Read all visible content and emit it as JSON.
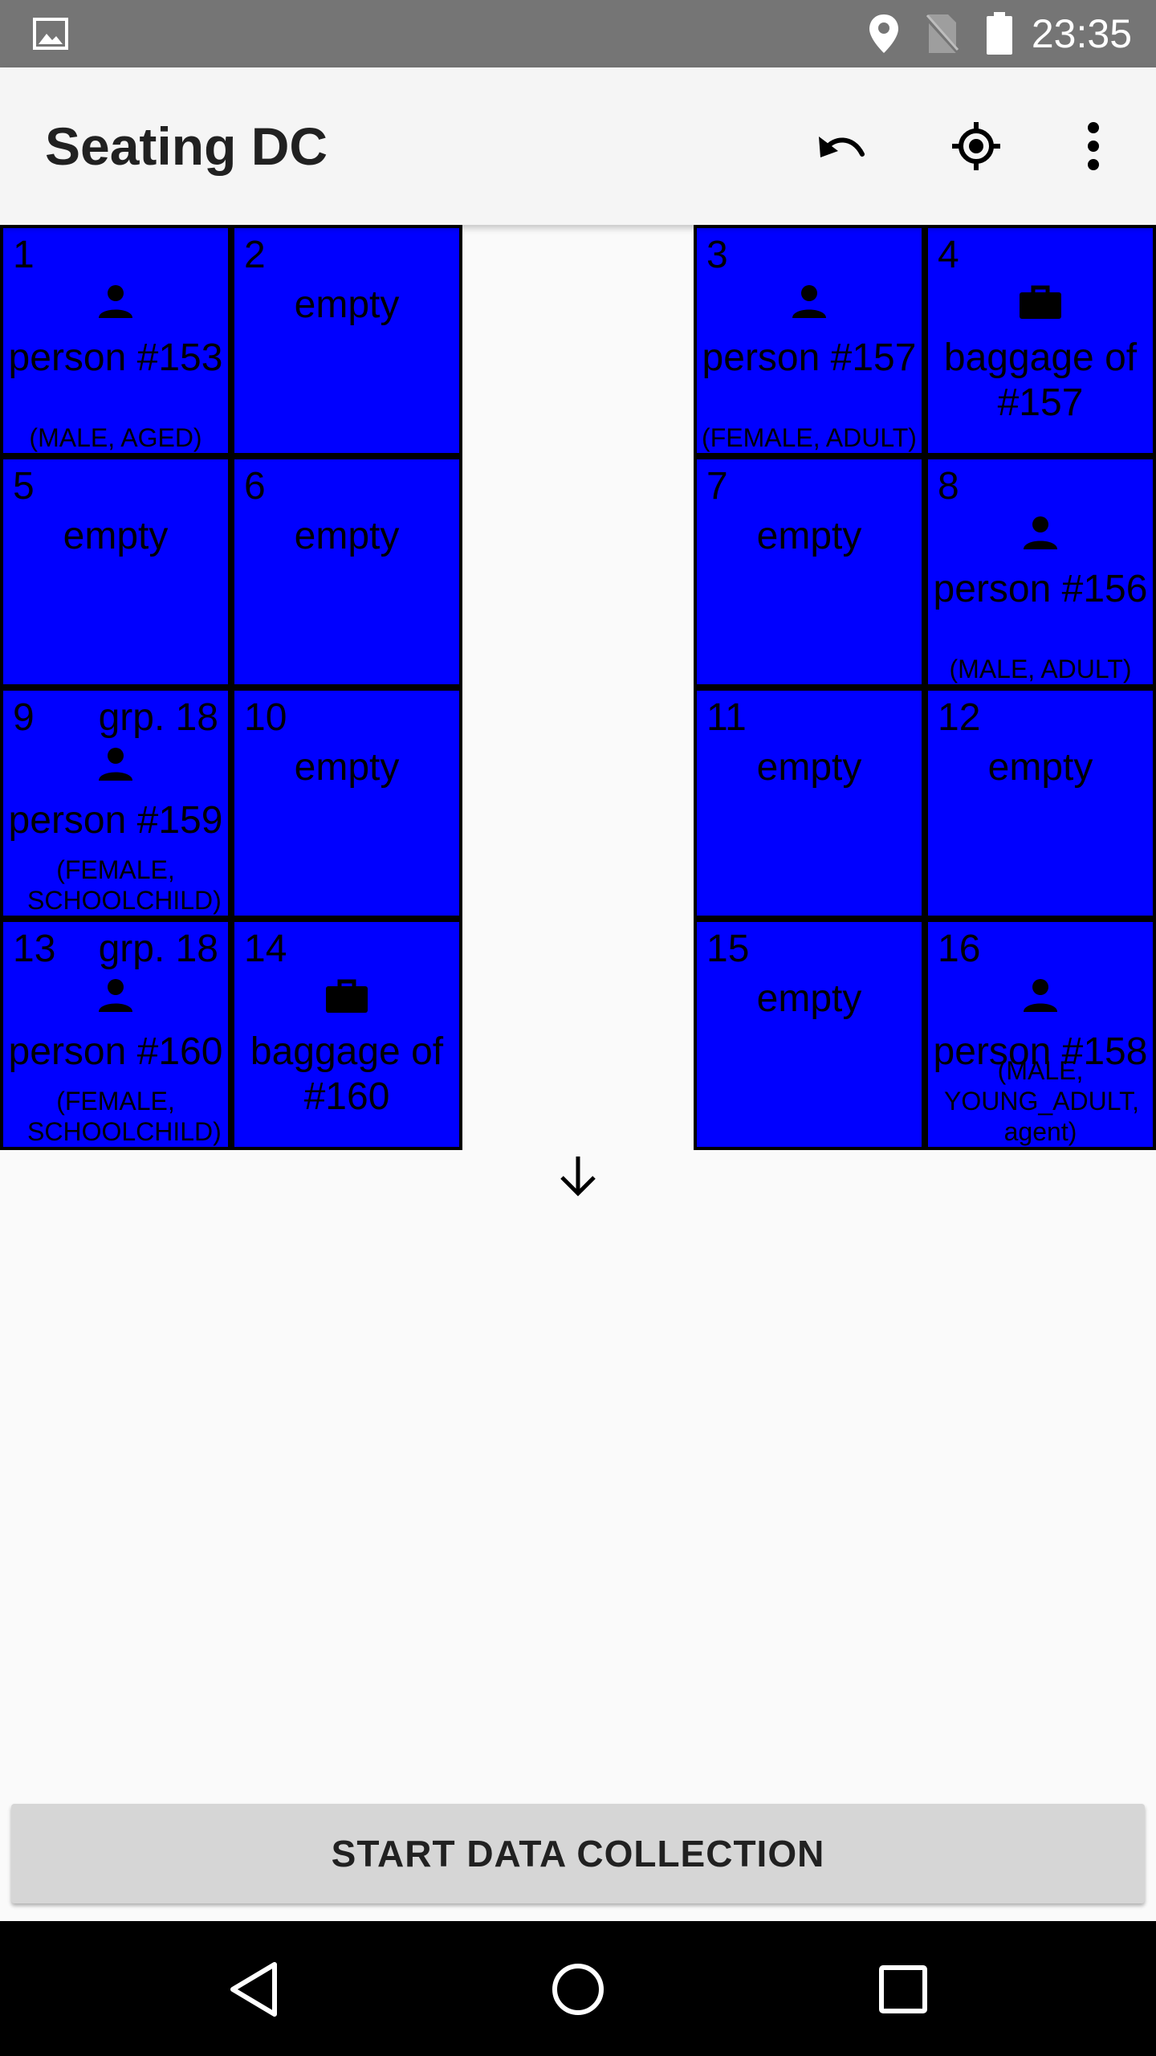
{
  "status_bar": {
    "time": "23:35",
    "icons": [
      "image-icon",
      "location-icon",
      "no-sim-icon",
      "battery-icon"
    ]
  },
  "app_bar": {
    "title": "Seating DC",
    "actions": [
      "undo-icon",
      "locate-icon",
      "more-vert-icon"
    ]
  },
  "seats": [
    {
      "number": "1",
      "group": "",
      "icon": "person",
      "label": "person #153",
      "detail": "(MALE, AGED)"
    },
    {
      "number": "2",
      "group": "",
      "icon": "",
      "label": "empty",
      "detail": ""
    },
    {
      "number": "3",
      "group": "",
      "icon": "person",
      "label": "person #157",
      "detail": "(FEMALE, ADULT)"
    },
    {
      "number": "4",
      "group": "",
      "icon": "baggage",
      "label": "baggage of #157",
      "detail": ""
    },
    {
      "number": "5",
      "group": "",
      "icon": "",
      "label": "empty",
      "detail": ""
    },
    {
      "number": "6",
      "group": "",
      "icon": "",
      "label": "empty",
      "detail": ""
    },
    {
      "number": "7",
      "group": "",
      "icon": "",
      "label": "empty",
      "detail": ""
    },
    {
      "number": "8",
      "group": "",
      "icon": "person",
      "label": "person #156",
      "detail": "(MALE, ADULT)"
    },
    {
      "number": "9",
      "group": "grp. 18",
      "icon": "person",
      "label": "person #159",
      "detail": "(FEMALE, SCHOOLCHILD)"
    },
    {
      "number": "10",
      "group": "",
      "icon": "",
      "label": "empty",
      "detail": ""
    },
    {
      "number": "11",
      "group": "",
      "icon": "",
      "label": "empty",
      "detail": ""
    },
    {
      "number": "12",
      "group": "",
      "icon": "",
      "label": "empty",
      "detail": ""
    },
    {
      "number": "13",
      "group": "grp. 18",
      "icon": "person",
      "label": "person #160",
      "detail": "(FEMALE, SCHOOLCHILD)"
    },
    {
      "number": "14",
      "group": "",
      "icon": "baggage",
      "label": "baggage of #160",
      "detail": ""
    },
    {
      "number": "15",
      "group": "",
      "icon": "",
      "label": "empty",
      "detail": ""
    },
    {
      "number": "16",
      "group": "",
      "icon": "person",
      "label": "person #158",
      "detail": "(MALE, YOUNG_ADULT, agent)"
    }
  ],
  "direction_indicator": "arrow-down-icon",
  "start_button": {
    "label": "START DATA COLLECTION"
  },
  "nav_bar": {
    "buttons": [
      "back-icon",
      "home-icon",
      "recents-icon"
    ]
  },
  "colors": {
    "seat_fill": "#0000ff",
    "seat_border": "#000000",
    "status_bar": "#757575",
    "app_bar": "#f5f5f5",
    "button": "#d6d6d6"
  }
}
